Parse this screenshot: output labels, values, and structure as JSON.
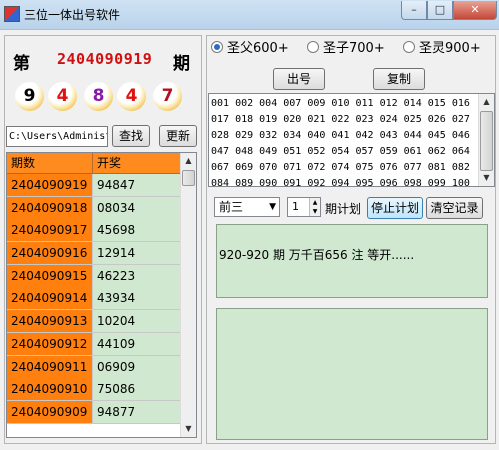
{
  "window": {
    "title": "三位一体出号软件",
    "min_label": "–",
    "max_label": "□",
    "close_label": "✕"
  },
  "left": {
    "issue_prefix": "第",
    "issue_number": "2404090919",
    "issue_suffix": "期",
    "balls": [
      "9",
      "4",
      "8",
      "4",
      "7"
    ],
    "ball_colors": [
      "#000000",
      "#e01010",
      "#8a1aa8",
      "#e01010",
      "#b01020"
    ],
    "path_value": "C:\\Users\\Administ",
    "search_label": "查找",
    "update_label": "更新",
    "table": {
      "headers": [
        "期数",
        "开奖"
      ],
      "rows": [
        [
          "2404090919",
          "94847"
        ],
        [
          "2404090918",
          "08034"
        ],
        [
          "2404090917",
          "45698"
        ],
        [
          "2404090916",
          "12914"
        ],
        [
          "2404090915",
          "46223"
        ],
        [
          "2404090914",
          "43934"
        ],
        [
          "2404090913",
          "10204"
        ],
        [
          "2404090912",
          "44109"
        ],
        [
          "2404090911",
          "06909"
        ],
        [
          "2404090910",
          "75086"
        ],
        [
          "2404090909",
          "94877"
        ]
      ]
    }
  },
  "right": {
    "radios": [
      {
        "label": "圣父600+",
        "checked": true
      },
      {
        "label": "圣子700+",
        "checked": false
      },
      {
        "label": "圣灵900+",
        "checked": false
      }
    ],
    "draw_label": "出号",
    "copy_label": "复制",
    "number_lines": [
      "001 002 004 007 009 010 011 012 014 015 016",
      "017 018 019 020 021 022 023 024 025 026 027",
      "028 029 032 034 040 041 042 043 044 045 046",
      "047 048 049 051 052 054 057 059 061 062 064",
      "067 069 070 071 072 074 075 076 077 081 082",
      "084 089 090 091 092 094 095 096 098 099 100"
    ],
    "position_select": "前三",
    "plan_count": "1",
    "plan_label": "期计划",
    "stop_plan_label": "停止计划",
    "clear_label": "清空记录",
    "status_text": "920-920 期 万千百656 注   等开......"
  },
  "colors": {
    "issue_number": "#d01010",
    "table_issue_bg": "#ff7f0f",
    "table_result_bg": "#cfe8cf",
    "panel_green": "#cfe8cf"
  }
}
